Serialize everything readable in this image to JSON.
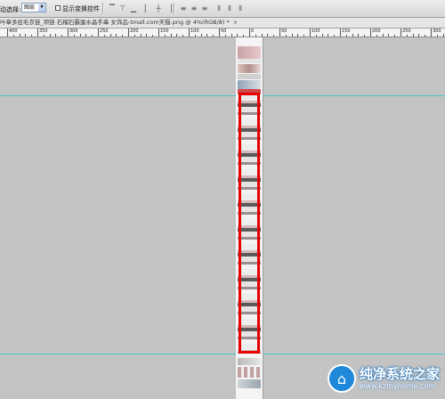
{
  "options_bar": {
    "select_label": "动选择:",
    "select_value": "图层",
    "show_transform_label": "显示变换控件"
  },
  "document_tab": {
    "title": "叶章多层毛衣链_项链 石榴石霸蛋水晶手串 女饰品-tmall.com天猫.png @ 4%(RGB/8) *",
    "close_glyph": "×"
  },
  "ruler": {
    "labels": [
      "400",
      "350",
      "300",
      "250",
      "200",
      "150",
      "100",
      "50",
      "0",
      "50",
      "100",
      "150",
      "200",
      "250",
      "300",
      "350",
      "400",
      "450"
    ]
  },
  "watermark": {
    "title": "纯净系统之家",
    "url": "www.kzmyhome.com"
  },
  "colors": {
    "selection_border": "#e60000",
    "guide": "#46c9cf",
    "canvas_bg": "#c3c3c3"
  }
}
